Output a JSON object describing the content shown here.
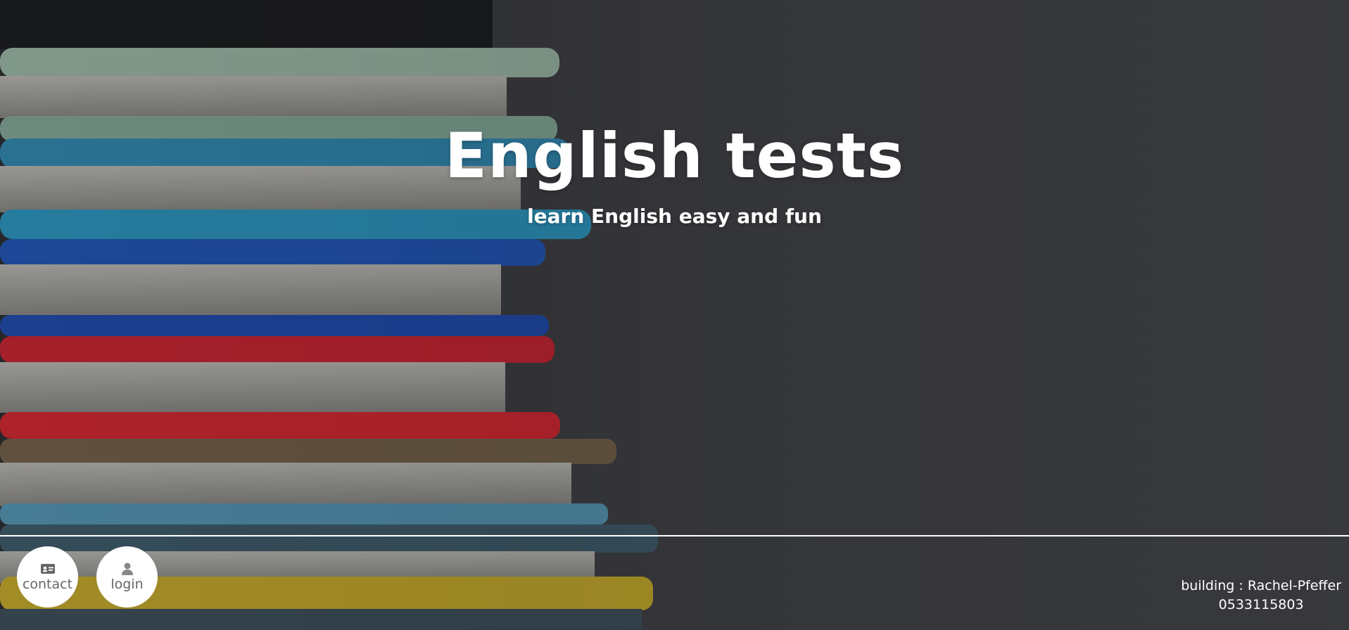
{
  "hero": {
    "title": "English tests",
    "subtitle": "learn English easy and fun"
  },
  "nav": {
    "contact": {
      "label": "contact",
      "icon": "contact-card-icon"
    },
    "login": {
      "label": "login",
      "icon": "user-icon"
    }
  },
  "footer": {
    "building": "building : Rachel-Pfeffer",
    "phone": "0533115803"
  },
  "colors": {
    "text": "#ffffff",
    "button_bg": "#ffffff",
    "button_text": "#666666",
    "background": "#3a3b3f"
  }
}
